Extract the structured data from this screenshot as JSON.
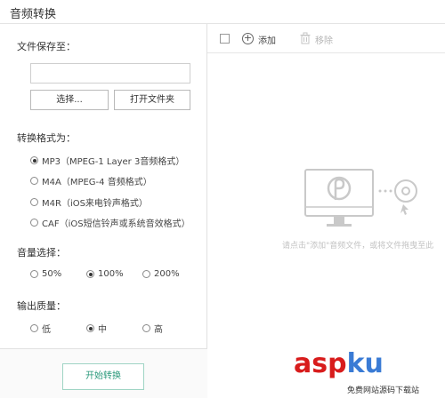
{
  "app": {
    "title": "音频转换"
  },
  "save": {
    "label": "文件保存至：",
    "path_value": "",
    "choose_label": "选择...",
    "open_folder_label": "打开文件夹"
  },
  "format": {
    "label": "转换格式为：",
    "options": [
      {
        "label": "MP3（MPEG-1 Layer 3音频格式）",
        "checked": true
      },
      {
        "label": "M4A（MPEG-4 音频格式）",
        "checked": false
      },
      {
        "label": "M4R（iOS来电铃声格式）",
        "checked": false
      },
      {
        "label": "CAF（iOS短信铃声或系统音效格式）",
        "checked": false
      }
    ]
  },
  "volume": {
    "label": "音量选择：",
    "options": [
      {
        "label": "50%",
        "checked": false
      },
      {
        "label": "100%",
        "checked": true
      },
      {
        "label": "200%",
        "checked": false
      }
    ]
  },
  "quality": {
    "label": "输出质量：",
    "options": [
      {
        "label": "低",
        "checked": false
      },
      {
        "label": "中",
        "checked": true
      },
      {
        "label": "高",
        "checked": false
      }
    ]
  },
  "start_label": "开始转换",
  "toolbar": {
    "add_label": "添加",
    "remove_label": "移除"
  },
  "empty_hint": "请点击\"添加\"音频文件，或将文件拖曳至此",
  "watermark": {
    "main_a": "asp",
    "main_b": "ku",
    "sub": "免费网站源码下载站"
  },
  "colors": {
    "accent": "#2c9a7c",
    "border": "#e0e0e0",
    "illustration": "#c9c9c9"
  }
}
